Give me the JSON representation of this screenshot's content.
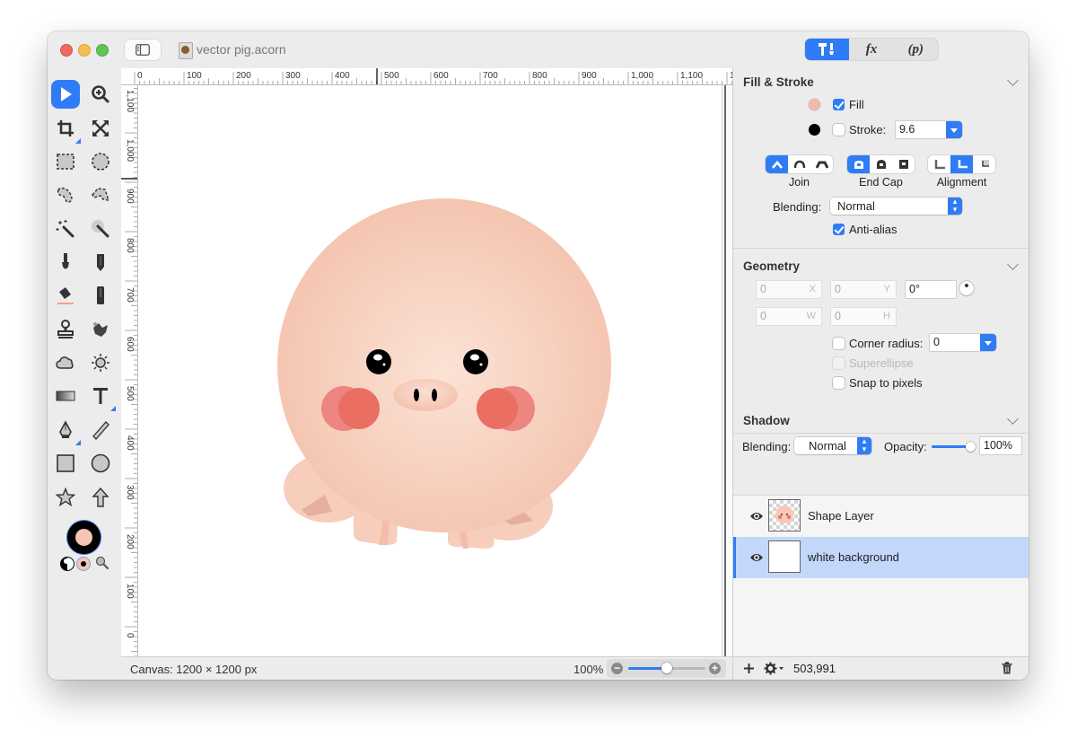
{
  "window": {
    "title": "vector pig.acorn",
    "inspector_tabs": [
      {
        "id": "tools",
        "label": "T!",
        "icon": "hammer-brush-icon",
        "active": true
      },
      {
        "id": "effects",
        "label": "fx",
        "active": false
      },
      {
        "id": "params",
        "label": "(p)",
        "active": false
      }
    ]
  },
  "toolbar": {
    "tools": [
      {
        "name": "select-tool",
        "icon": "arrow-pointer-icon",
        "active": true
      },
      {
        "name": "zoom-tool",
        "icon": "zoom-in-icon"
      },
      {
        "name": "crop-tool",
        "icon": "crop-icon",
        "has_submenu": true
      },
      {
        "name": "transform-tool",
        "icon": "resize-arrows-icon"
      },
      {
        "name": "rect-select-tool",
        "icon": "rect-marquee-icon"
      },
      {
        "name": "ellipse-select-tool",
        "icon": "ellipse-marquee-icon"
      },
      {
        "name": "lasso-tool",
        "icon": "lasso-icon"
      },
      {
        "name": "polygon-lasso-tool",
        "icon": "polygon-lasso-icon"
      },
      {
        "name": "magic-wand-tool",
        "icon": "magic-wand-icon"
      },
      {
        "name": "instant-alpha-tool",
        "icon": "instant-alpha-icon"
      },
      {
        "name": "brush-tool",
        "icon": "paintbrush-icon"
      },
      {
        "name": "pencil-tool",
        "icon": "pencil-icon"
      },
      {
        "name": "fill-tool",
        "icon": "paint-bucket-icon"
      },
      {
        "name": "eraser-tool",
        "icon": "eraser-icon"
      },
      {
        "name": "clone-tool",
        "icon": "stamp-icon"
      },
      {
        "name": "smudge-tool",
        "icon": "smudge-icon"
      },
      {
        "name": "cloud-tool",
        "icon": "cloud-icon"
      },
      {
        "name": "dodge-burn-tool",
        "icon": "sun-icon"
      },
      {
        "name": "gradient-tool",
        "icon": "gradient-icon"
      },
      {
        "name": "text-tool",
        "icon": "text-icon",
        "has_submenu": true
      },
      {
        "name": "pen-tool",
        "icon": "pen-nib-icon",
        "has_submenu": true
      },
      {
        "name": "line-tool",
        "icon": "line-icon"
      },
      {
        "name": "rectangle-tool",
        "icon": "square-shape-icon"
      },
      {
        "name": "oval-tool",
        "icon": "circle-shape-icon"
      },
      {
        "name": "star-tool",
        "icon": "star-icon"
      },
      {
        "name": "arrow-tool",
        "icon": "arrow-up-icon"
      }
    ],
    "colors": {
      "fill": "#f5c5b4",
      "stroke": "#000000"
    }
  },
  "rulers": {
    "horizontal": [
      "0",
      "100",
      "200",
      "300",
      "400",
      "500",
      "600",
      "700",
      "800",
      "900",
      "1,000",
      "1,100",
      "1,"
    ],
    "vertical": [
      "1,100",
      "1,000",
      "900",
      "800",
      "700",
      "600",
      "500",
      "400",
      "300",
      "200",
      "100",
      "0"
    ]
  },
  "status": {
    "canvas_size": "Canvas: 1200 × 1200 px",
    "zoom": "100%",
    "zoom_slider_fraction": 0.5,
    "coordinates": "503,991"
  },
  "fill_stroke": {
    "title": "Fill & Stroke",
    "fill": {
      "label": "Fill",
      "checked": true,
      "color": "#f4b9a9"
    },
    "stroke": {
      "label": "Stroke:",
      "checked": false,
      "color": "#000000",
      "width": "9.6"
    },
    "join": {
      "label": "Join",
      "selected": 0
    },
    "end_cap": {
      "label": "End Cap",
      "selected": 0
    },
    "alignment": {
      "label": "Alignment",
      "selected": 1
    },
    "blending_label": "Blending:",
    "blending_value": "Normal",
    "anti_alias": {
      "label": "Anti-alias",
      "checked": true
    }
  },
  "geometry": {
    "title": "Geometry",
    "x": {
      "value": "0",
      "suffix": "X"
    },
    "y": {
      "value": "0",
      "suffix": "Y"
    },
    "rotation": "0°",
    "w": {
      "value": "0",
      "suffix": "W"
    },
    "h": {
      "value": "0",
      "suffix": "H"
    },
    "corner_radius": {
      "label": "Corner radius:",
      "checked": false,
      "value": "0"
    },
    "superellipse": {
      "label": "Superellipse",
      "checked": false,
      "disabled": true
    },
    "snap_to_pixels": {
      "label": "Snap to pixels",
      "checked": false
    }
  },
  "shadow": {
    "title": "Shadow",
    "blending_label": "Blending:",
    "blending_value": "Normal",
    "opacity_label": "Opacity:",
    "opacity_value": "100%",
    "opacity_fraction": 1.0
  },
  "layers": [
    {
      "name": "Shape Layer",
      "visible": true,
      "selected": false
    },
    {
      "name": "white background",
      "visible": true,
      "selected": true
    }
  ],
  "colors": {
    "accent": "#2f7cf6",
    "selection": "#c3d7fa",
    "pig_skin": "#f7c9b5",
    "cheek": "#ea6f62"
  }
}
